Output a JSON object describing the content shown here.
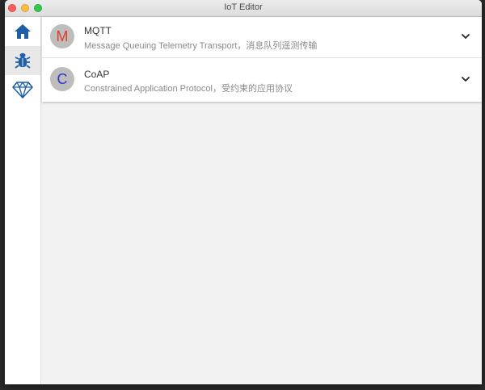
{
  "window": {
    "title": "IoT Editor"
  },
  "sidebar": {
    "items": [
      {
        "icon": "home-icon",
        "active": false
      },
      {
        "icon": "bug-icon",
        "active": true
      },
      {
        "icon": "diamond-icon",
        "active": false
      }
    ],
    "accent_color": "#1e5fa8"
  },
  "protocols": [
    {
      "letter": "M",
      "letter_color": "#e23b2e",
      "name": "MQTT",
      "description": "Message Queuing Telemetry Transport，消息队列遥测传输"
    },
    {
      "letter": "C",
      "letter_color": "#2f34c9",
      "name": "CoAP",
      "description": "Constrained Application Protocol，受约束的应用协议"
    }
  ]
}
